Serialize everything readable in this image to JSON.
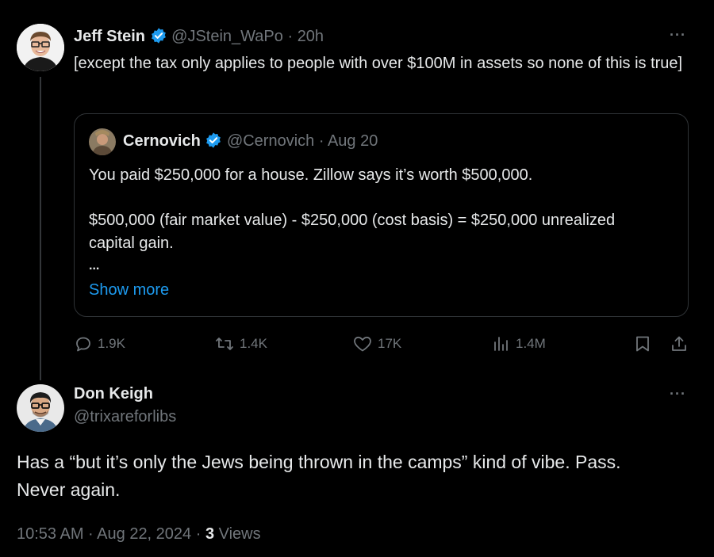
{
  "tweet1": {
    "author_name": "Jeff Stein",
    "handle": "@JStein_WaPo",
    "separator": "·",
    "time": "20h",
    "text": "[except the tax only applies to people with over $100M in assets so none of this is true]"
  },
  "quote": {
    "author_name": "Cernovich",
    "handle": "@Cernovich",
    "separator": "·",
    "date": "Aug 20",
    "line1": "You paid $250,000 for a house. Zillow says it’s worth $500,000.",
    "line2": "$500,000 (fair market value) - $250,000 (cost basis) = $250,000 unrealized capital gain.",
    "ellipsis": "...",
    "show_more": "Show more"
  },
  "actions": {
    "replies": "1.9K",
    "reposts": "1.4K",
    "likes": "17K",
    "views": "1.4M"
  },
  "tweet2": {
    "author_name": "Don Keigh",
    "handle": "@trixareforlibs",
    "text": "Has a “but it’s only the Jews being thrown in the camps” kind of vibe. Pass. Never again.",
    "timestamp": "10:53 AM · Aug 22, 2024 · ",
    "views_count": "3",
    "views_label": " Views"
  },
  "colors": {
    "background": "#000000",
    "text": "#e7e9ea",
    "muted": "#71767b",
    "link": "#1d9bf0",
    "verified": "#1d9bf0",
    "border": "#2f3336"
  },
  "icons": [
    "more-icon",
    "verified-badge-icon",
    "reply-icon",
    "repost-icon",
    "like-icon",
    "views-icon",
    "bookmark-icon",
    "share-icon"
  ]
}
